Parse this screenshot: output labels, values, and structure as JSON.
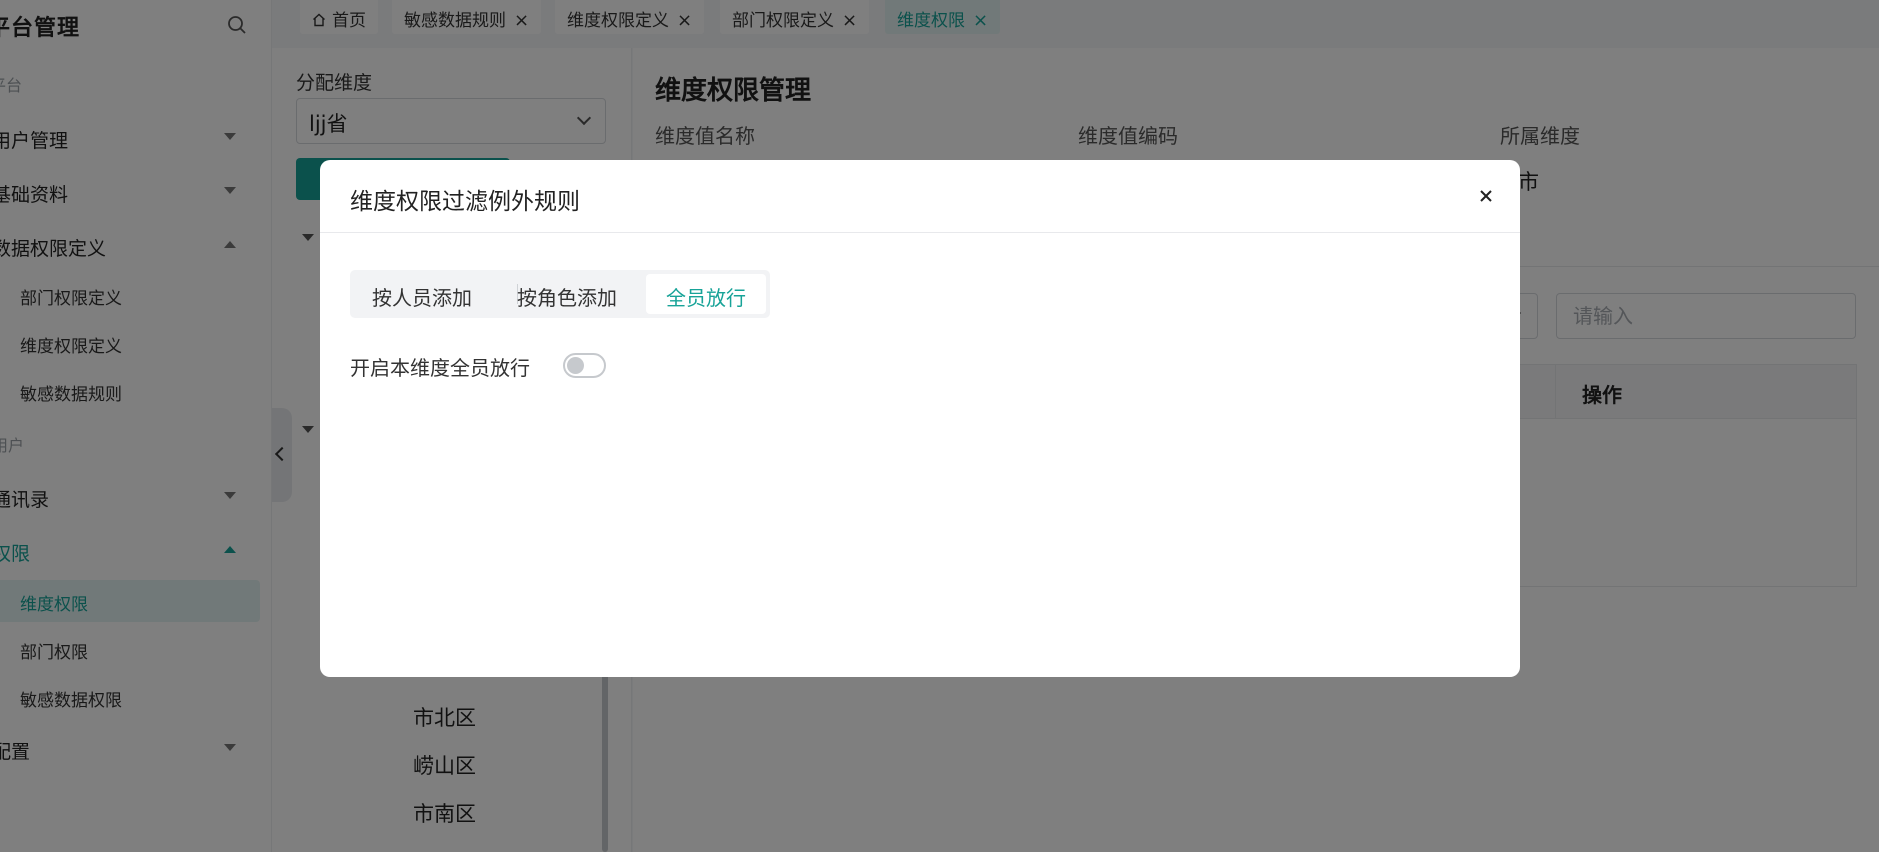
{
  "sidebar": {
    "title": "平台管理",
    "groups": [
      "平台",
      "用户"
    ],
    "menus": [
      {
        "label": "用户管理"
      },
      {
        "label": "基础资料"
      },
      {
        "label": "数据权限定义"
      },
      {
        "label": "通讯录"
      },
      {
        "label": "权限"
      },
      {
        "label": "配置"
      }
    ],
    "subs": [
      {
        "label": "部门权限定义"
      },
      {
        "label": "维度权限定义"
      },
      {
        "label": "敏感数据规则"
      },
      {
        "label": "维度权限"
      },
      {
        "label": "部门权限"
      },
      {
        "label": "敏感数据权限"
      }
    ]
  },
  "tabs": [
    {
      "label": "首页"
    },
    {
      "label": "敏感数据规则"
    },
    {
      "label": "维度权限定义"
    },
    {
      "label": "部门权限定义"
    },
    {
      "label": "维度权限"
    }
  ],
  "tree": {
    "label": "分配维度",
    "select_value": "ljj省",
    "nodes": [
      "市北区",
      "崂山区",
      "市南区"
    ]
  },
  "main": {
    "title": "维度权限管理",
    "fields": [
      "维度值名称",
      "维度值编码",
      "所属维度"
    ],
    "value_text": "市",
    "search_placeholder": "请输入",
    "table_col": "操作"
  },
  "modal": {
    "title": "维度权限过滤例外规则",
    "close_icon": "×",
    "segments": [
      "按人员添加",
      "按角色添加",
      "全员放行"
    ],
    "active_segment": "全员放行",
    "toggle_label": "开启本维度全员放行",
    "toggle_on": false
  },
  "colors": {
    "accent": "#17a398",
    "overlay": "rgba(0,0,0,0.5)"
  }
}
